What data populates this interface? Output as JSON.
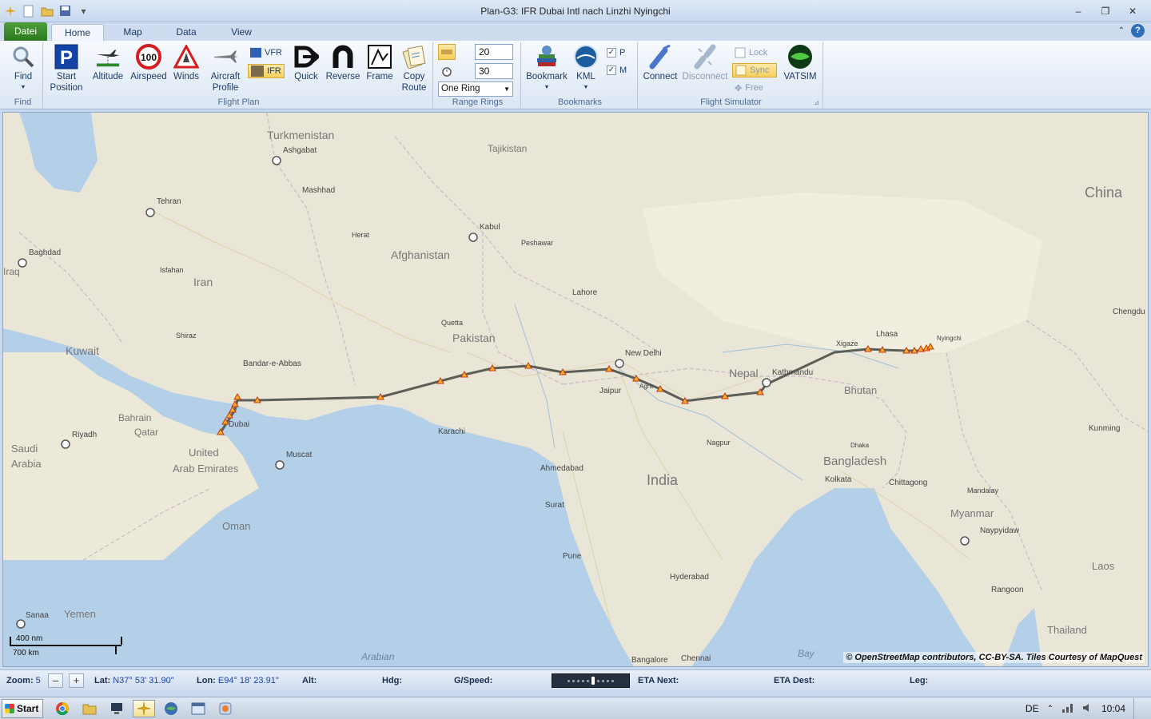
{
  "window": {
    "title": "Plan-G3: IFR Dubai Intl nach Linzhi Nyingchi",
    "controls": [
      "–",
      "❐",
      "✕"
    ]
  },
  "tabs": {
    "file": "Datei",
    "items": [
      "Home",
      "Map",
      "Data",
      "View"
    ]
  },
  "ribbon": {
    "find": {
      "button": "Find",
      "group": "Find"
    },
    "flight_plan": {
      "group": "Flight Plan",
      "start_position": [
        "Start",
        "Position"
      ],
      "altitude": "Altitude",
      "airspeed": "Airspeed",
      "airspeed_value": "100",
      "winds": "Winds",
      "aircraft_profile": [
        "Aircraft",
        "Profile"
      ],
      "vfr": "VFR",
      "ifr": "IFR",
      "quick": "Quick",
      "reverse": "Reverse",
      "frame": "Frame",
      "copy_route": [
        "Copy",
        "Route"
      ]
    },
    "range_rings": {
      "group": "Range Rings",
      "value1": "20",
      "value2": "30",
      "ring_mode": "One Ring"
    },
    "bookmarks": {
      "group": "Bookmarks",
      "bookmark": "Bookmark",
      "kml": "KML",
      "p": "P",
      "m": "M"
    },
    "flight_simulator": {
      "group": "Flight Simulator",
      "connect": "Connect",
      "disconnect": "Disconnect",
      "lock": "Lock",
      "sync": "Sync",
      "free": "Free",
      "vatsim": "VATSIM"
    }
  },
  "map": {
    "attribution": "© OpenStreetMap contributors, CC-BY-SA. Tiles Courtesy of MapQuest",
    "scale": {
      "nm": "400 nm",
      "km": "700 km"
    },
    "countries": [
      "Turkmenistan",
      "Afghanistan",
      "Iran",
      "Pakistan",
      "Kuwait",
      "Bahrain",
      "Qatar",
      "Saudi",
      "Arabia",
      "United",
      "Arab Emirates",
      "Oman",
      "Yemen",
      "India",
      "Nepal",
      "Bhutan",
      "Bangladesh",
      "Myanmar",
      "Thailand",
      "China",
      "Laos",
      "Tajikistan",
      "Iraq"
    ],
    "cities": [
      "Ashgabat",
      "Mashhad",
      "Tehran",
      "Kabul",
      "Baghdad",
      "Riyadh",
      "Muscat",
      "Karachi",
      "New Delhi",
      "Kathmandu",
      "Lhasa",
      "Jaipur",
      "Ahmedabad",
      "Lahore",
      "Dubai",
      "Bandar-e-Abbas",
      "Hyderabad",
      "Kolkata",
      "Dhaka",
      "Chittagong",
      "Sanaa",
      "Rangoon",
      "Naypyidaw",
      "Agra",
      "Quetta",
      "Peshawar",
      "Shiraz",
      "Isfahan",
      "Herat",
      "Mandalay",
      "Kunming",
      "Chengdu",
      "Nyingchi",
      "Xigaze",
      "Surat",
      "Pune",
      "Nagpur",
      "Chennai",
      "Bangalore"
    ],
    "seas": [
      "Arabian",
      "Bay"
    ]
  },
  "status": {
    "zoom_label": "Zoom:",
    "zoom_value": "5",
    "zoom_minus": "–",
    "zoom_plus": "+",
    "lat_label": "Lat:",
    "lat_value": "N37° 53' 31.90\"",
    "lon_label": "Lon:",
    "lon_value": "E94° 18' 23.91\"",
    "alt_label": "Alt:",
    "hdg_label": "Hdg:",
    "gspeed_label": "G/Speed:",
    "eta_next_label": "ETA Next:",
    "eta_dest_label": "ETA Dest:",
    "leg_label": "Leg:"
  },
  "taskbar": {
    "start": "Start",
    "lang": "DE",
    "time": "10:04"
  },
  "colors": {
    "route": "#5b5f58",
    "waypoint": "#f3b12a",
    "water": "#b4d0e8",
    "land": "#ece9d8"
  }
}
